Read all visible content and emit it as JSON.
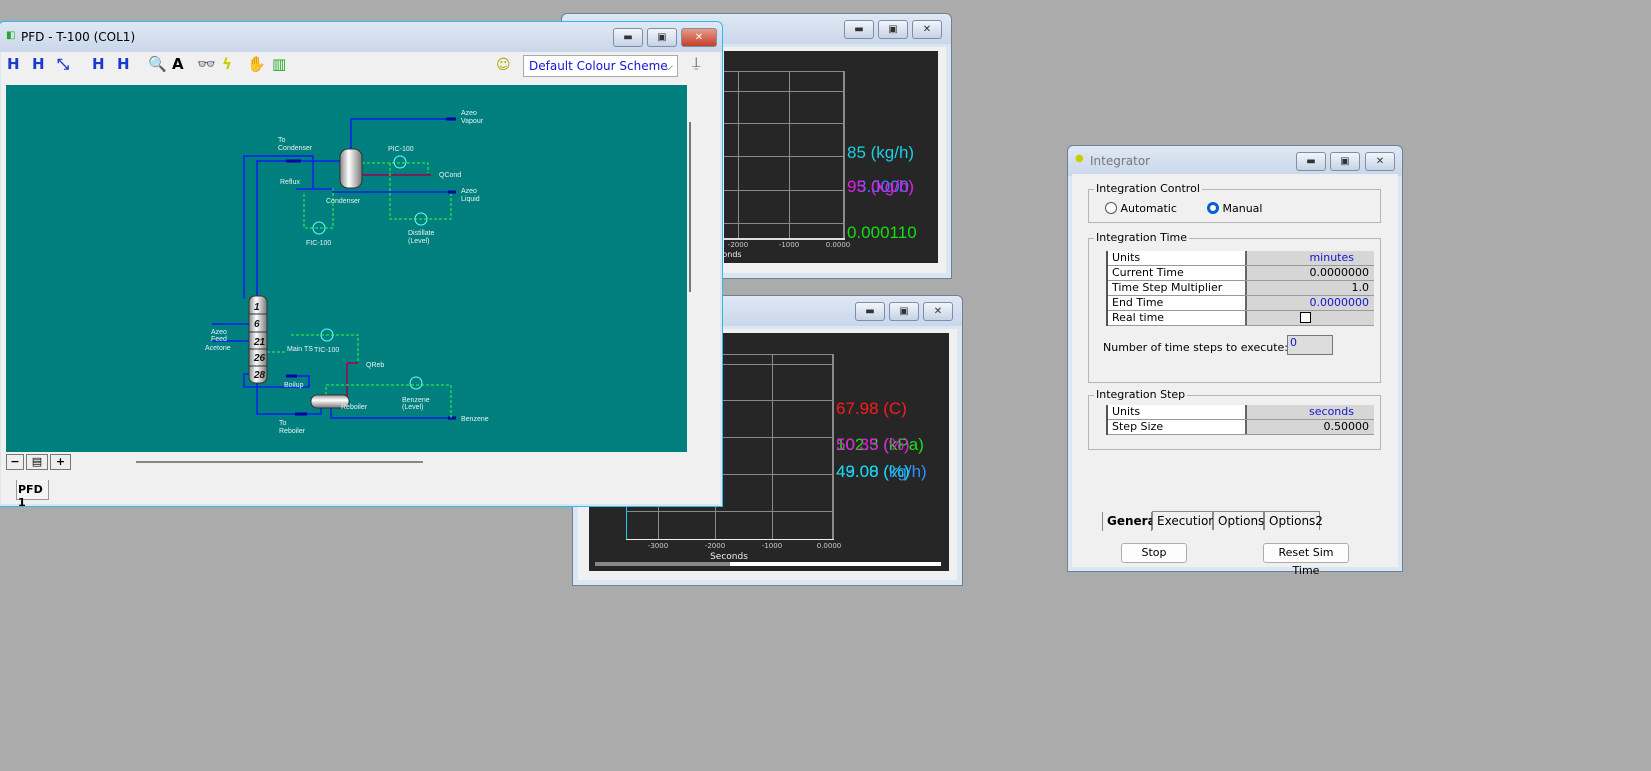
{
  "pfd": {
    "title": "PFD - T-100 (COL1)",
    "colour_scheme": "Default Colour Scheme",
    "tab": "PFD 1",
    "zoom_out": "−",
    "zoom_in": "+",
    "toolbar_icons": [
      "h-icon",
      "h-lightning-icon",
      "resize-icon",
      "h-attach-icon",
      "h-break-icon",
      "magnifier-icon",
      "text-icon",
      "binoculars-icon",
      "lightning-icon",
      "hand-icon",
      "traffic-light-icon"
    ],
    "labels": {
      "azeo_vapour_1": "Azeo",
      "azeo_vapour_2": "Vapour",
      "to_condenser_1": "To",
      "to_condenser_2": "Condenser",
      "pic": "PIC-100",
      "qcond": "QCond",
      "reflux": "Reflux",
      "condenser": "Condenser",
      "azeo_liquid_1": "Azeo",
      "azeo_liquid_2": "Liquid",
      "fic": "FIC-100",
      "distillate_1": "Distillate",
      "distillate_2": "(Level)",
      "feed_1": "Azeo",
      "feed_2": "Feed",
      "feed_3": "Acetone",
      "main_ts": "Main TS",
      "tic": "TIC-100",
      "qreb": "QReb",
      "boilup": "Boilup",
      "reboiler": "Reboiler",
      "benzene_lvl_1": "Benzene",
      "benzene_lvl_2": "(Level)",
      "benzene": "Benzene",
      "to_reboiler_1": "To",
      "to_reboiler_2": "Reboiler",
      "stages": [
        "1",
        "6",
        "21",
        "26",
        "28"
      ]
    }
  },
  "strip1": {
    "ticks": [
      "-2000",
      "-1000",
      "0.0000"
    ],
    "xlabel": "onds",
    "values": [
      {
        "text": "85 (kg/h)",
        "color": "#19d0e0"
      },
      {
        "text": "3.0000",
        "color": "#2f7fff"
      },
      {
        "text": "95 (kg/h)",
        "color": "#e020e0"
      },
      {
        "text": "0.000110",
        "color": "#12e012"
      }
    ]
  },
  "strip2": {
    "ticks": [
      "-3000",
      "-2000",
      "-1000",
      "0.0000"
    ],
    "xlabel": "Seconds",
    "values": [
      {
        "text": "67.98 (C)",
        "color": "#ff1a1a"
      },
      {
        "text": "102.3 (kPa)",
        "color": "#18e018"
      },
      {
        "text": "50.35 (%)",
        "color": "#e020e0"
      },
      {
        "text": "43.00 (kg/h)",
        "color": "#2f8fff"
      },
      {
        "text": "49.08 (%)",
        "color": "#19d8e8"
      }
    ]
  },
  "integrator": {
    "title": "Integrator",
    "control": {
      "legend": "Integration Control",
      "automatic": "Automatic",
      "manual": "Manual",
      "selected": "Manual"
    },
    "time": {
      "legend": "Integration Time",
      "rows": [
        [
          "Units",
          "minutes"
        ],
        [
          "Current Time",
          "0.0000000"
        ],
        [
          "Time Step Multiplier",
          "1.0"
        ],
        [
          "End Time",
          "0.0000000"
        ],
        [
          "Real time",
          ""
        ]
      ],
      "real_time_checked": false,
      "steps_label": "Number of time steps to execute:",
      "steps_value": "0"
    },
    "step": {
      "legend": "Integration Step",
      "rows": [
        [
          "Units",
          "seconds"
        ],
        [
          "Step Size",
          "0.50000"
        ]
      ]
    },
    "tabs": [
      "General",
      "Execution",
      "Options",
      "Options2"
    ],
    "active_tab": "General",
    "stop": "Stop",
    "reset": "Reset Sim Time"
  }
}
